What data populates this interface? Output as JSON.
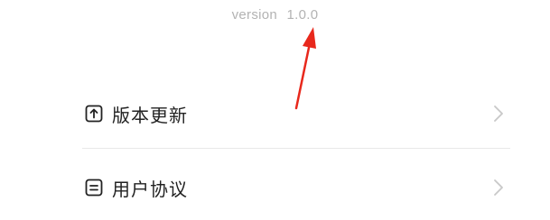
{
  "version": {
    "prefix": "version",
    "number": "1.0.0"
  },
  "menu": {
    "items": [
      {
        "label": "版本更新",
        "icon": "upload-icon"
      },
      {
        "label": "用户协议",
        "icon": "document-icon"
      }
    ]
  },
  "colors": {
    "version_text": "#b3b3b3",
    "label_text": "#222222",
    "chevron": "#c8c8c8",
    "divider": "#e8e8e8",
    "annotation_arrow": "#e8281c"
  }
}
